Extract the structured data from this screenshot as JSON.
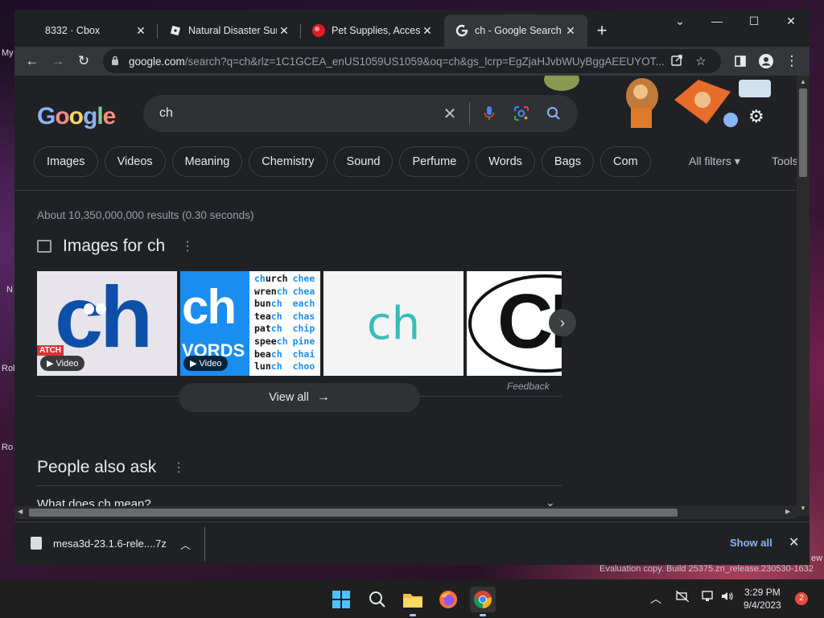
{
  "desktop": {
    "labels": [
      "My",
      "N",
      "Rol",
      "Ro",
      "ew"
    ]
  },
  "tabs": [
    {
      "title": "8332 · Cbox",
      "favicon": "cbox-icon",
      "close": "✕"
    },
    {
      "title": "Natural Disaster Survi",
      "favicon": "roblox-icon",
      "close": "✕"
    },
    {
      "title": "Pet Supplies, Accesso",
      "favicon": "chewy-icon",
      "close": "✕"
    },
    {
      "title": "ch - Google Search",
      "favicon": "google-icon",
      "close": "✕"
    }
  ],
  "newtab": "+",
  "window_controls": {
    "dropdown": "⌄",
    "minimize": "—",
    "maximize": "☐",
    "close": "✕"
  },
  "toolbar": {
    "back": "←",
    "forward": "→",
    "reload": "↻",
    "url_host": "google.com",
    "url_rest": "/search?q=ch&rlz=1C1GCEA_enUS1059US1059&oq=ch&gs_lcrp=EgZjaHJvbWUyBggAEEUYOT..."
  },
  "search": {
    "query": "ch",
    "clear": "✕"
  },
  "chips": [
    "Images",
    "Videos",
    "Meaning",
    "Chemistry",
    "Sound",
    "Perfume",
    "Words",
    "Bags",
    "Com"
  ],
  "filters": {
    "all_filters": "All filters ▾",
    "tools": "Tools"
  },
  "results": {
    "stats": "About 10,350,000,000 results (0.30 seconds)",
    "images_title": "Images for ch",
    "video_badge": "▶ Video",
    "feedback": "Feedback",
    "view_all": "View all",
    "paa_title": "People also ask",
    "paa_q1": "What does ch mean?"
  },
  "thumb_texts": {
    "t1": "ch",
    "t1_cut": "ATCH",
    "t2": "ch",
    "t2_cut": "VORDS",
    "words_col1": [
      "church",
      "wrench",
      "bunch",
      "teach",
      "patch",
      "speech",
      "beach",
      "lunch"
    ],
    "words_col2": [
      "chee",
      "chea",
      "each",
      "chas",
      "chip",
      "pine",
      "chai",
      "choo"
    ],
    "t3": "ch",
    "t4": "CH"
  },
  "download": {
    "file": "mesa3d-23.1.6-rele....7z",
    "show_all": "Show all"
  },
  "watermark": "Evaluation copy. Build 25375.zn_release.230530-1632",
  "clock": {
    "time": "3:29 PM",
    "date": "9/4/2023"
  },
  "notifications": "2",
  "colors": {
    "accent": "#8ab4f8",
    "page_bg": "#202124"
  }
}
